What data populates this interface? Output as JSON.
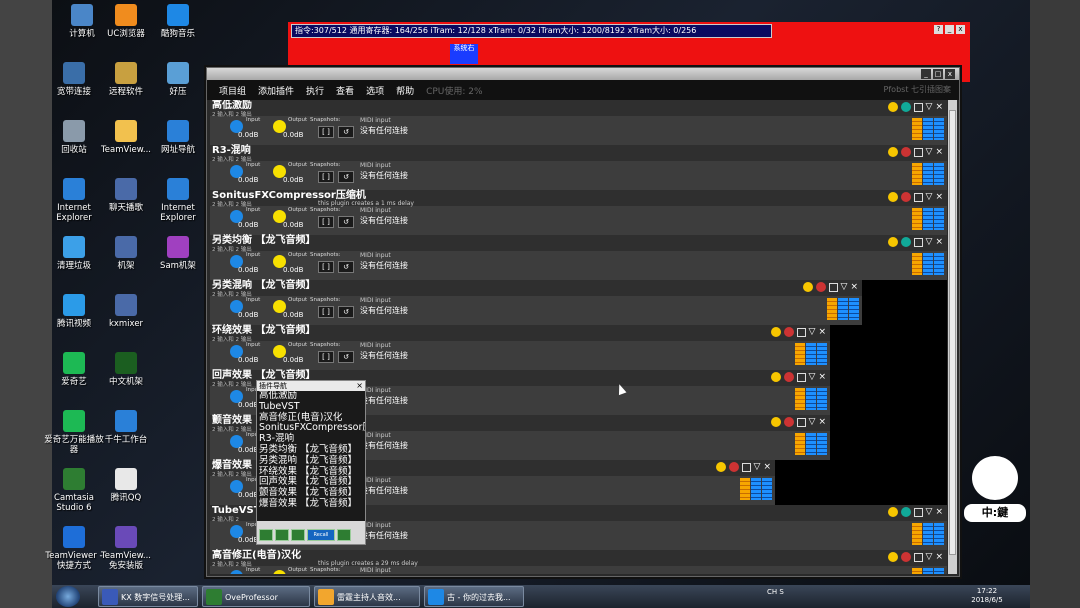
{
  "desktop_icons": [
    {
      "label": "计算机",
      "color": "#4a86c8"
    },
    {
      "label": "UC浏览器",
      "color": "#f08c1e"
    },
    {
      "label": "酷狗音乐",
      "color": "#1e88e5"
    },
    {
      "label": "宽带连接",
      "color": "#3a6ea8"
    },
    {
      "label": "远程软件",
      "color": "#c8a040"
    },
    {
      "label": "好压",
      "color": "#5a9fd6"
    },
    {
      "label": "回收站",
      "color": "#8a9aaa"
    },
    {
      "label": "TeamView...",
      "color": "#f2c14e"
    },
    {
      "label": "网址导航",
      "color": "#2a80d8"
    },
    {
      "label": "Internet Explorer",
      "color": "#2a80d8"
    },
    {
      "label": "聊天播歌",
      "color": "#4a6aa8"
    },
    {
      "label": "Internet Explorer",
      "color": "#2a80d8"
    },
    {
      "label": "清理垃圾",
      "color": "#3ca0e8"
    },
    {
      "label": "机架",
      "color": "#4a6aa8"
    },
    {
      "label": "Sam机架",
      "color": "#a040c0"
    },
    {
      "label": "腾讯视频",
      "color": "#2b9be8"
    },
    {
      "label": "kxmixer",
      "color": "#4a6aa8"
    },
    {
      "label": "爱奇艺",
      "color": "#1db954"
    },
    {
      "label": "中文机架",
      "color": "#1b5e20"
    },
    {
      "label": "爱奇艺万能播放器",
      "color": "#1db954"
    },
    {
      "label": "千牛工作台",
      "color": "#2a80d8"
    },
    {
      "label": "Camtasia Studio 6",
      "color": "#2e7d32"
    },
    {
      "label": "腾讯QQ",
      "color": "#e8e8e8"
    },
    {
      "label": "TeamViewer - 快捷方式",
      "color": "#1e6ed8"
    },
    {
      "label": "TeamView... 免安装版",
      "color": "#6a4ab8"
    }
  ],
  "redwin": {
    "title": "指令:307/512 通用寄存器: 164/256 iTram: 12/128 xTram: 0/32 iTram大小: 1200/8192 xTram大小: 0/256",
    "badge": "系统右"
  },
  "mainwin": {
    "menu": [
      "项目组",
      "添加插件",
      "执行",
      "查看",
      "选项",
      "帮助"
    ],
    "menu_dim": "CPU使用: 2%",
    "menu_right": "Pfobst 七引插图案"
  },
  "common": {
    "input_label": "Input",
    "output_label": "Output",
    "snap_label": "Snapshots:",
    "midi_label": "MIDI input",
    "midi_value": "没有任何连接",
    "db": "0.0dB"
  },
  "plugins": [
    {
      "name": "高低激励",
      "desc": "2 输入和 2 输出",
      "note": "",
      "status": "#1a9"
    },
    {
      "name": "R3-混响",
      "desc": "2 输入和 2 输出",
      "note": "",
      "status": "#c33"
    },
    {
      "name": "SonitusFXCompressor压缩机",
      "desc": "2 输入和 2 输出",
      "note": "this plugin creates a 1 ms delay",
      "status": "#c33"
    },
    {
      "name": "另类均衡 【龙飞音频】",
      "desc": "2 输入和 2 输出",
      "note": "",
      "status": "#1a9"
    },
    {
      "name": "另类混响 【龙飞音频】",
      "desc": "2 输入和 2 输出",
      "note": "",
      "status": "#c33"
    },
    {
      "name": "环绕效果 【龙飞音频】",
      "desc": "2 输入和 2 输出",
      "note": "",
      "status": "#c33"
    },
    {
      "name": "回声效果 【龙飞音频】",
      "desc": "2 输入和 2 输出",
      "note": "",
      "status": "#c33"
    },
    {
      "name": "颤音效果",
      "desc": "2 输入和 2 输出",
      "note": "",
      "status": "#c33"
    },
    {
      "name": "爆音效果",
      "desc": "2 输入和 2 输出",
      "note": "",
      "status": "#c33"
    },
    {
      "name": "TubeVST",
      "desc": "2 输入和 2",
      "note": "",
      "status": "#1a9"
    },
    {
      "name": "高音修正(电音)汉化",
      "desc": "2 输入和 2 输出",
      "note": "this plugin creates a 29 ms delay",
      "status": "#c33"
    }
  ],
  "popup": {
    "title": "插件导航",
    "items": [
      "高低激励",
      "TubeVST",
      "高音修正(电音)汉化",
      "SonitusFXCompressor压缩机",
      "R3-混响",
      "另类均衡 【龙飞音频】",
      "另类混响 【龙飞音频】",
      "环绕效果 【龙飞音频】",
      "回声效果 【龙飞音频】",
      "颤音效果 【龙飞音频】",
      "爆音效果 【龙飞音频】"
    ],
    "btn_label": "Recall"
  },
  "mascot": {
    "sign": "中:鍵"
  },
  "taskbar": {
    "items": [
      {
        "label": "KX 数字信号处理...",
        "color": "#3a5ab8"
      },
      {
        "label": "OveProfessor",
        "color": "#2e7d32"
      },
      {
        "label": "雷霆主持人音效...",
        "color": "#f2a62e"
      },
      {
        "label": "古 - 你的过去我...",
        "color": "#1e88e5"
      }
    ],
    "tray": "CH  S",
    "time": "17:22",
    "date": "2018/6/5"
  }
}
